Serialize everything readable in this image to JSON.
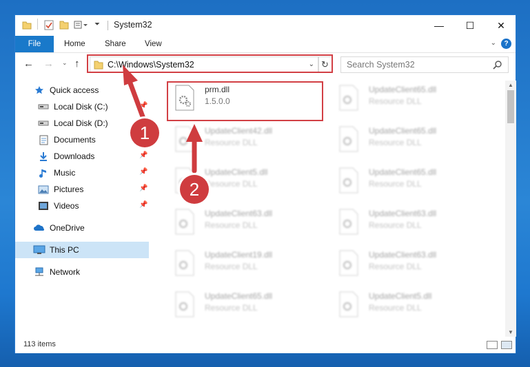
{
  "window": {
    "title": "System32",
    "controls": {
      "minimize": "—",
      "maximize": "☐",
      "close": "✕"
    }
  },
  "ribbon": {
    "tabs": [
      "File",
      "Home",
      "Share",
      "View"
    ],
    "help": "?"
  },
  "address": {
    "path": "C:\\Windows\\System32",
    "search_placeholder": "Search System32"
  },
  "sidebar": {
    "items": [
      {
        "label": "Quick access",
        "icon": "star-icon"
      },
      {
        "label": "Local Disk (C:)",
        "icon": "drive-icon",
        "pinned": true
      },
      {
        "label": "Local Disk (D:)",
        "icon": "drive-icon"
      },
      {
        "label": "Documents",
        "icon": "documents-icon"
      },
      {
        "label": "Downloads",
        "icon": "download-icon",
        "pinned": true
      },
      {
        "label": "Music",
        "icon": "music-icon",
        "pinned": true
      },
      {
        "label": "Pictures",
        "icon": "pictures-icon",
        "pinned": true
      },
      {
        "label": "Videos",
        "icon": "videos-icon",
        "pinned": true
      },
      {
        "label": "OneDrive",
        "icon": "cloud-icon"
      },
      {
        "label": "This PC",
        "icon": "monitor-icon",
        "selected": true
      },
      {
        "label": "Network",
        "icon": "network-icon"
      }
    ]
  },
  "files": {
    "highlighted": {
      "name": "prm.dll",
      "version": "1.5.0.0"
    },
    "right_column": [
      {
        "name": "UpdateClient65.dll",
        "type": "Resource DLL"
      },
      {
        "name": "UpdateClient65.dll",
        "type": "Resource DLL"
      },
      {
        "name": "UpdateClient65.dll",
        "type": "Resource DLL"
      },
      {
        "name": "UpdateClient63.dll",
        "type": "Resource DLL"
      },
      {
        "name": "UpdateClient63.dll",
        "type": "Resource DLL"
      },
      {
        "name": "UpdateClient5.dll",
        "type": "Resource DLL"
      }
    ],
    "left_column": [
      {
        "name": "UpdateClient42.dll",
        "type": "Resource DLL"
      },
      {
        "name": "UpdateClient5.dll",
        "type": "Resource DLL"
      },
      {
        "name": "UpdateClient63.dll",
        "type": "Resource DLL"
      },
      {
        "name": "UpdateClient19.dll",
        "type": "Resource DLL"
      },
      {
        "name": "UpdateClient65.dll",
        "type": "Resource DLL"
      }
    ]
  },
  "status": {
    "item_count": "113 items"
  },
  "annotations": {
    "step1": "1",
    "step2": "2"
  },
  "colors": {
    "accent": "#1979ca",
    "highlight": "#d23f44",
    "selected": "#cce4f7"
  }
}
